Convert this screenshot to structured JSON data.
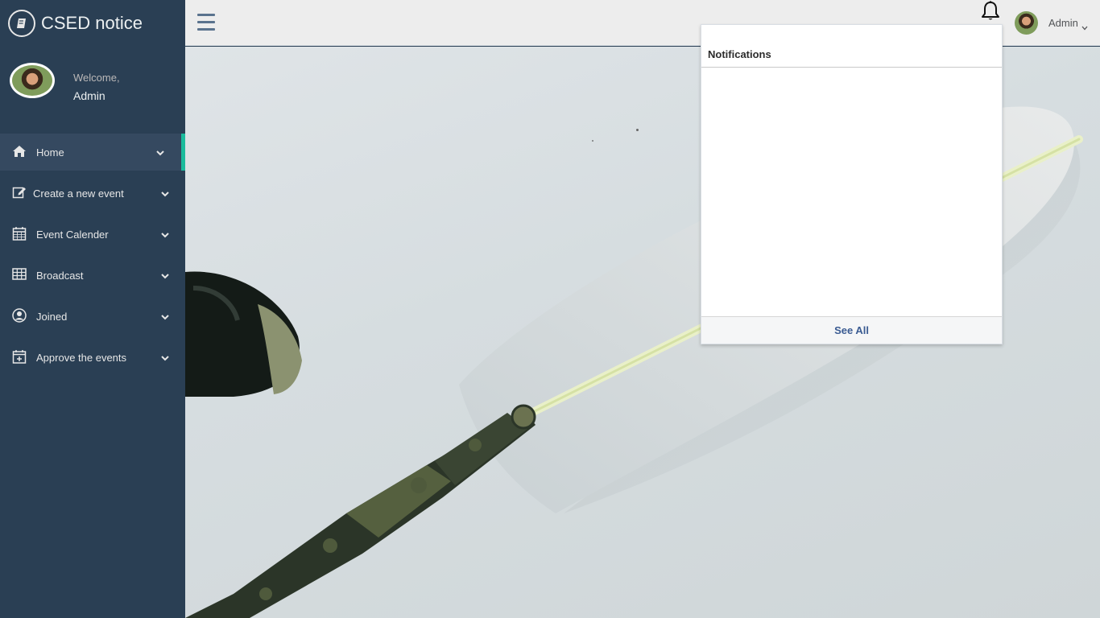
{
  "brand": {
    "title": "CSED notice",
    "icon": "book-icon"
  },
  "profile": {
    "welcome": "Welcome,",
    "name": "Admin"
  },
  "sidebar": {
    "items": [
      {
        "label": "Home",
        "icon": "home-icon",
        "active": true
      },
      {
        "label": "Create a new event",
        "icon": "edit-icon",
        "active": false
      },
      {
        "label": "Event Calender",
        "icon": "calendar-icon",
        "active": false
      },
      {
        "label": "Broadcast",
        "icon": "table-icon",
        "active": false
      },
      {
        "label": "Joined",
        "icon": "user-circle-icon",
        "active": false
      },
      {
        "label": "Approve the events",
        "icon": "calendar-plus-icon",
        "active": false
      }
    ]
  },
  "topnav": {
    "menu_icon": "hamburger-icon",
    "bell_icon": "bell-icon",
    "user": {
      "name": "Admin"
    }
  },
  "notifications": {
    "title": "Notifications",
    "footer_link": "See All"
  },
  "colors": {
    "sidebar_bg": "#2a3f54",
    "active_accent": "#1abb9c",
    "topnav_bg": "#ededed",
    "link": "#3a5b92"
  }
}
